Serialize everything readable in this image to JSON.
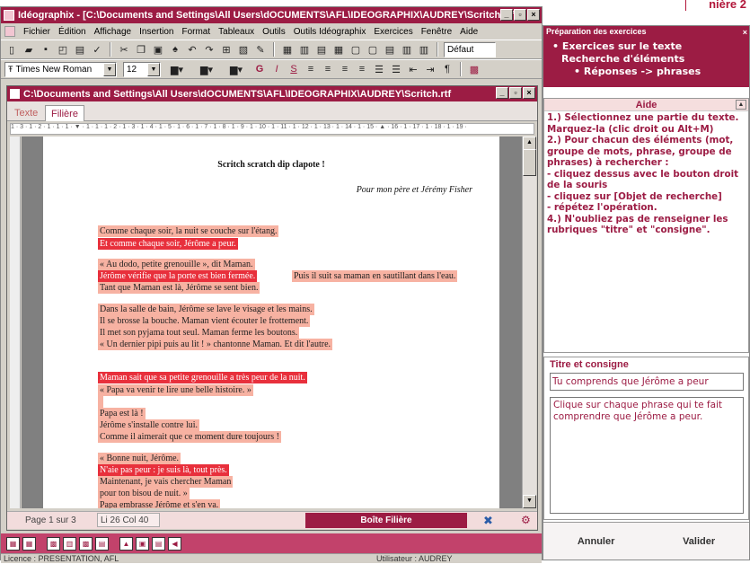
{
  "corner_label": "nière 2",
  "app": {
    "title": "Idéographix - [C:\\Documents and Settings\\All Users\\dOCUMENTS\\AFL\\IDEOGRAPHIX\\AUDREY\\Scritch.rtf]",
    "menu": [
      "Fichier",
      "Édition",
      "Affichage",
      "Insertion",
      "Format",
      "Tableaux",
      "Outils",
      "Outils Idéographix",
      "Exercices",
      "Fenêtre",
      "Aide"
    ],
    "style_combo": "Défaut",
    "font_combo": "Times New Roman",
    "size_combo": "12",
    "format_b": "G",
    "format_i": "I",
    "format_u": "S",
    "format_para": "¶"
  },
  "doc": {
    "title": "C:\\Documents and Settings\\All Users\\dOCUMENTS\\AFL\\IDEOGRAPHIX\\AUDREY\\Scritch.rtf",
    "tabs": [
      "Texte",
      "Filière"
    ],
    "ruler": "1 · 3 · 1 · 2 · 1 · 1 · 1 · ▼ · 1 · 1 · 1 · 2 · 1 · 3 · 1 · 4 · 1 · 5 · 1 · 6 · 1 · 7 · 1 · 8 · 1 · 9 · 1 · 10 · 1 · 11 · 1 · 12 · 1 · 13 · 1 · 14 · 1 · 15 · ▲ · 16 · 1 · 17 · 1 · 18 · 1 · 19 ·",
    "heading": "Scritch scratch dip clapote !",
    "dedication": "Pour mon père et Jérémy Fisher",
    "lines": [
      {
        "text": "Comme chaque soir, la nuit se couche sur l'étang.",
        "hl": "light"
      },
      {
        "text": "Et comme chaque soir, Jérôme a peur.",
        "hl": "dark"
      },
      {
        "text": "« Au dodo, petite grenouille », dit Maman.",
        "hl": "light"
      },
      {
        "text": "Jérôme vérifie que la porte est bien fermée.",
        "hl": "dark"
      },
      {
        "text": " Puis il suit sa maman en sautillant dans l'eau.",
        "hl": "light"
      },
      {
        "text": "Tant que Maman est là, Jérôme se sent bien.",
        "hl": "light"
      },
      {
        "text": "Dans la salle de bain, Jérôme se lave le visage et les mains.",
        "hl": "light"
      },
      {
        "text": "Il se brosse la bouche. Maman vient écouter le frottement.",
        "hl": "light"
      },
      {
        "text": "Il met son pyjama tout seul. Maman ferme les boutons.",
        "hl": "light"
      },
      {
        "text": "« Un dernier pipi puis au lit ! » chantonne Maman. Et dit l'autre.",
        "hl": "light"
      },
      {
        "text": "Maman sait que sa petite grenouille a très peur de la nuit.",
        "hl": "dark"
      },
      {
        "text": "« Papa va venir te lire une belle histoire. »",
        "hl": "light"
      },
      {
        "text": " ",
        "hl": "light"
      },
      {
        "text": "Papa est là !",
        "hl": "light"
      },
      {
        "text": "Jérôme s'installe contre lui.",
        "hl": "light"
      },
      {
        "text": "Comme il aimerait que ce moment dure toujours !",
        "hl": "light"
      },
      {
        "text": "« Bonne nuit, Jérôme.",
        "hl": "light"
      },
      {
        "text": "N'aie pas peur : je suis là, tout près.",
        "hl": "dark"
      },
      {
        "text": "Maintenant, je vais chercher Maman",
        "hl": "light"
      },
      {
        "text": "pour ton bisou de nuit. »",
        "hl": "light"
      },
      {
        "text": "Papa embrasse Jérôme et s'en va.",
        "hl": "light"
      }
    ],
    "status": {
      "page": "Page 1 sur 3",
      "position": "Li 26   Col 40",
      "filiere_button": "Boîte Filière"
    }
  },
  "licence": "Licence : PRESENTATION, AFL",
  "user": "Utilisateur : AUDREY",
  "panel": {
    "header": "Préparation des exercices",
    "tree": [
      "• Exercices sur le texte",
      "Recherche d'éléments",
      "• Réponses -> phrases"
    ],
    "aide_title": "Aide",
    "aide_lines": [
      "1.) Sélectionnez une partie du texte.",
      "Marquez-la (clic droit ou Alt+M)",
      "2.) Pour chacun des éléments (mot,",
      "groupe de mots, phrase, groupe de",
      "phrases) à rechercher :",
      "- cliquez dessus avec le bouton droit",
      "de la souris",
      "- cliquez sur [Objet de recherche]",
      "- répétez l'opération.",
      "4.) N'oubliez pas de renseigner les",
      "rubriques \"titre\" et \"consigne\"."
    ],
    "titre_label": "Titre et consigne",
    "titre_value": "Tu comprends que Jérôme a peur",
    "consigne_value": "Clique sur chaque phrase qui te fait comprendre que Jérôme a peur.",
    "cancel": "Annuler",
    "validate": "Valider"
  }
}
